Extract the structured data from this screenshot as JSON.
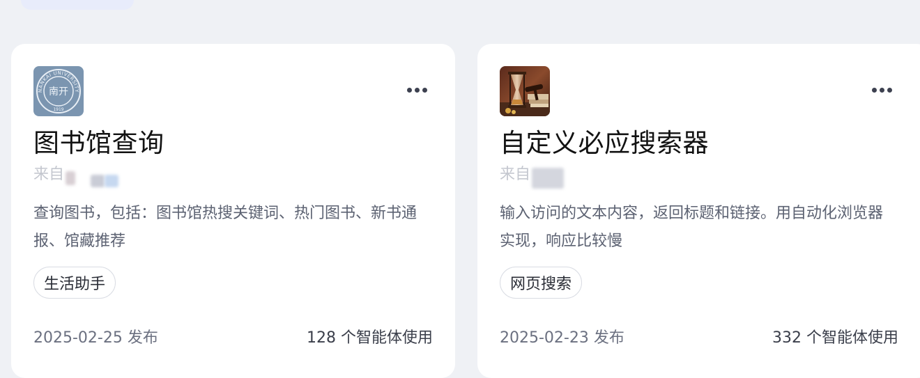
{
  "cards": [
    {
      "avatar_icon": "nankai-university-seal",
      "title": "图书馆查询",
      "source_prefix": "来自",
      "description": "查询图书，包括：图书馆热搜关键词、热门图书、新书通报、馆藏推荐",
      "tag": "生活助手",
      "date": "2025-02-25 发布",
      "usage": "128 个智能体使用"
    },
    {
      "avatar_icon": "hourglass-gavel-photo",
      "title": "自定义必应搜索器",
      "source_prefix": "来自",
      "description": "输入访问的文本内容，返回标题和链接。用自动化浏览器实现，响应比较慢",
      "tag": "网页搜索",
      "date": "2025-02-23 发布",
      "usage": "332 个智能体使用"
    }
  ],
  "seal_text": {
    "top": "NANKAI UNIVERSITY",
    "year": "1919",
    "center": "南开"
  },
  "colors": {
    "page_bg": "#eff1f5",
    "card_bg": "#ffffff",
    "seal_bg": "#7b95b0"
  }
}
